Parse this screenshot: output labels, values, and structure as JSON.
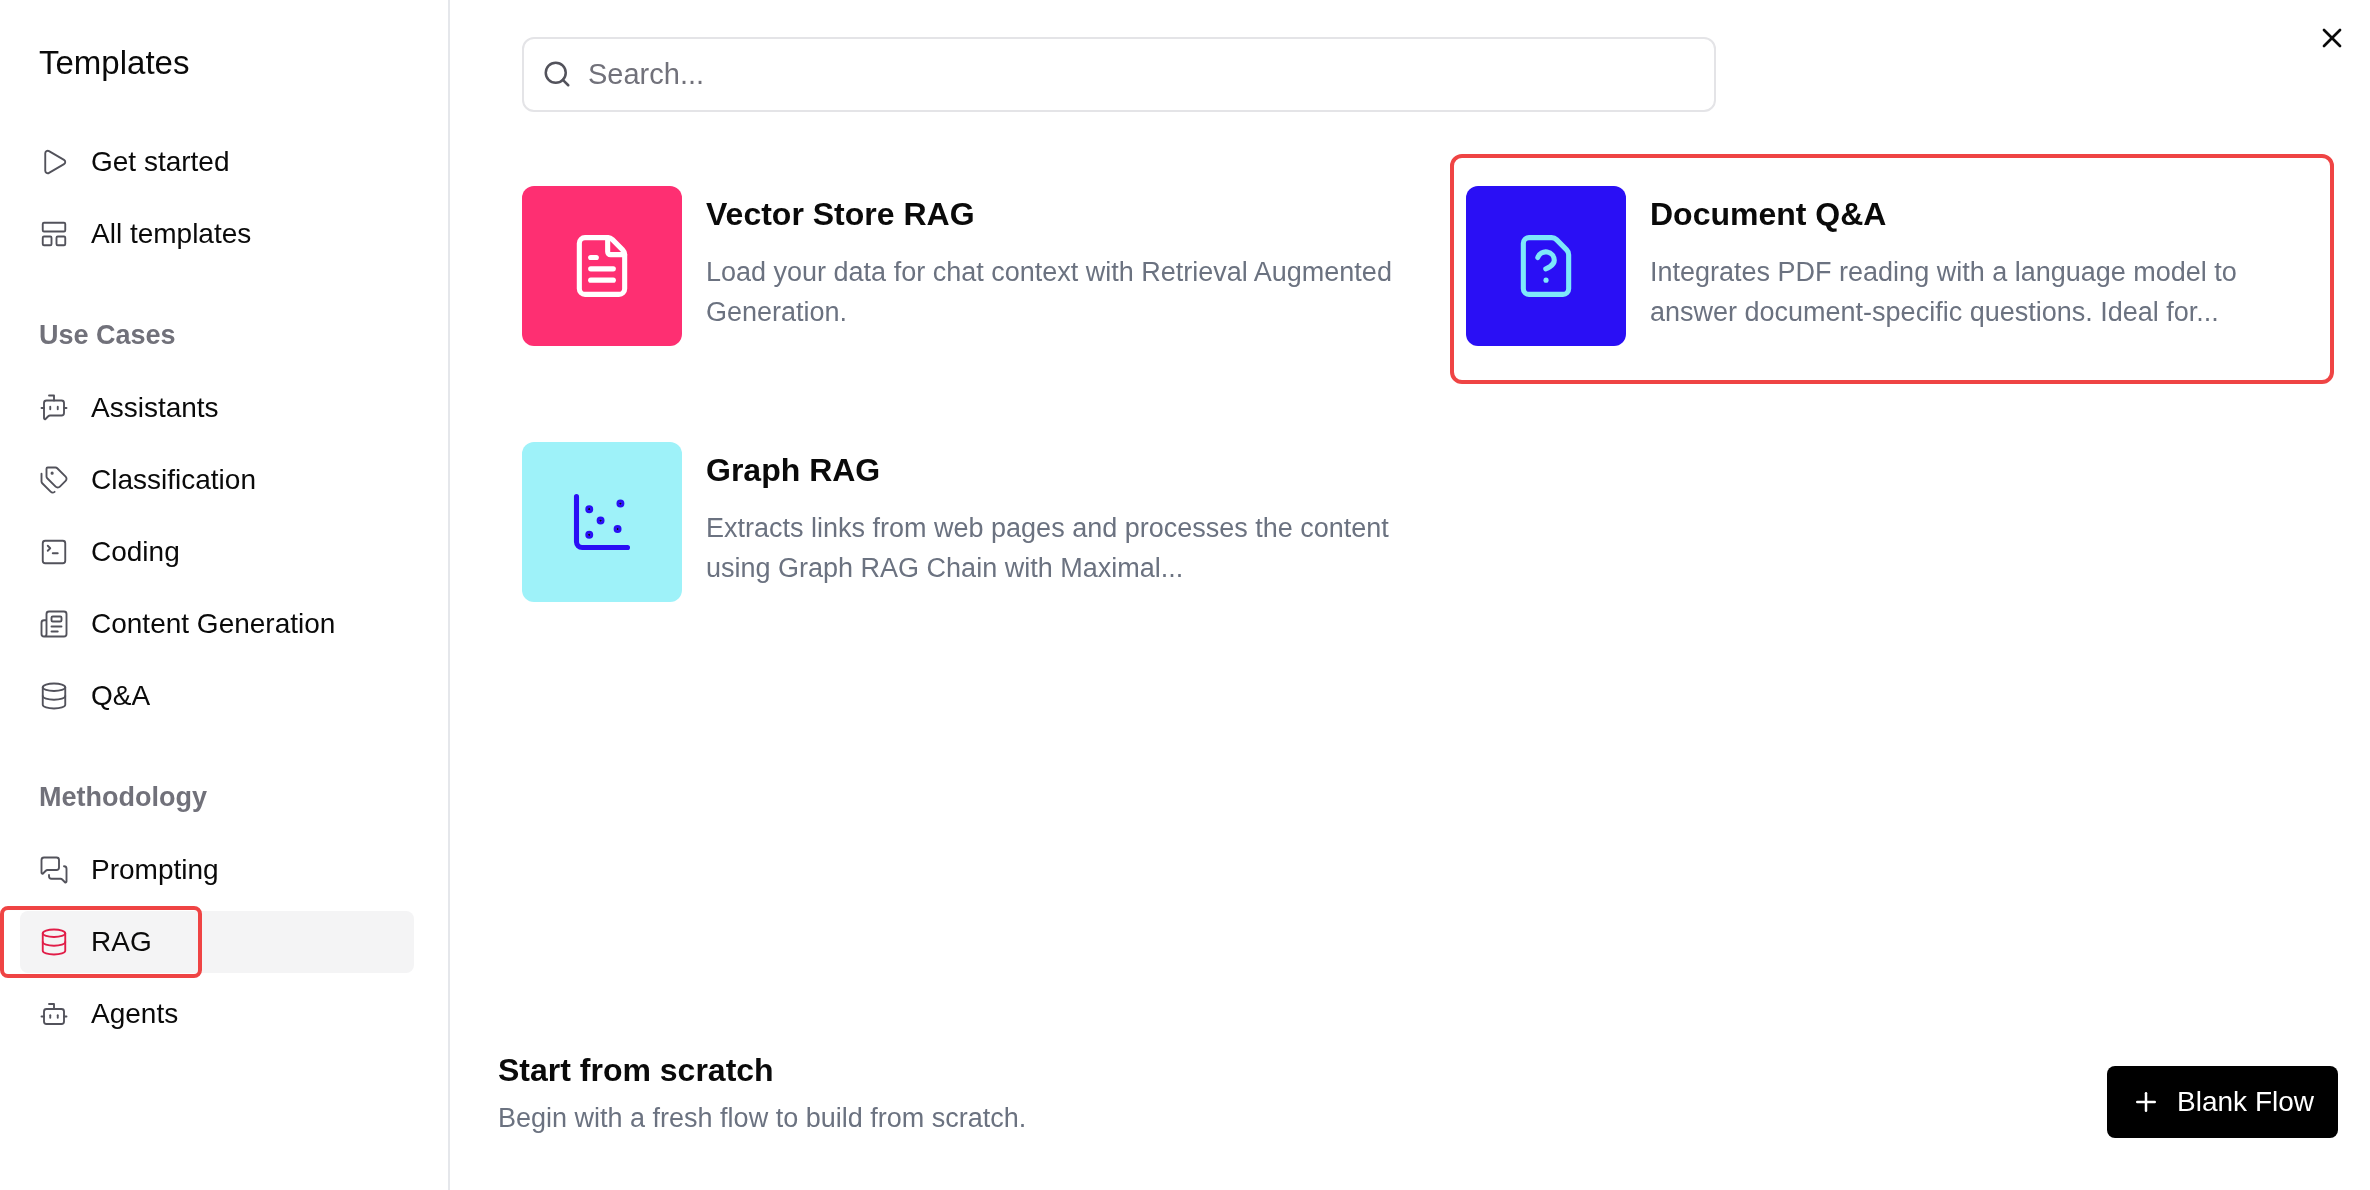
{
  "sidebar": {
    "title": "Templates",
    "groups": [
      {
        "items": [
          {
            "label": "Get started",
            "selected": false,
            "highlighted": false
          },
          {
            "label": "All templates",
            "selected": false,
            "highlighted": false
          }
        ]
      },
      {
        "heading": "Use Cases",
        "items": [
          {
            "label": "Assistants",
            "selected": false,
            "highlighted": false
          },
          {
            "label": "Classification",
            "selected": false,
            "highlighted": false
          },
          {
            "label": "Coding",
            "selected": false,
            "highlighted": false
          },
          {
            "label": "Content Generation",
            "selected": false,
            "highlighted": false
          },
          {
            "label": "Q&A",
            "selected": false,
            "highlighted": false
          }
        ]
      },
      {
        "heading": "Methodology",
        "items": [
          {
            "label": "Prompting",
            "selected": false,
            "highlighted": false
          },
          {
            "label": "RAG",
            "selected": true,
            "highlighted": true
          },
          {
            "label": "Agents",
            "selected": false,
            "highlighted": false
          }
        ]
      }
    ]
  },
  "search": {
    "placeholder": "Search..."
  },
  "templates": [
    {
      "title": "Vector Store RAG",
      "description": "Load your data for chat context with Retrieval Augmented Generation.",
      "kind": "document",
      "color": "#fe2f72",
      "highlighted": false
    },
    {
      "title": "Document Q&A",
      "description": "Integrates PDF reading with a language model to answer document-specific questions. Ideal for...",
      "kind": "question",
      "color": "#2a0ff5",
      "highlighted": true
    },
    {
      "title": "Graph RAG",
      "description": "Extracts links from web pages and processes the content using Graph RAG Chain with Maximal...",
      "kind": "graph",
      "color": "#9ef2f9",
      "highlighted": false
    }
  ],
  "footer": {
    "title": "Start from scratch",
    "description": "Begin with a fresh flow to build from scratch.",
    "button": "Blank Flow"
  }
}
